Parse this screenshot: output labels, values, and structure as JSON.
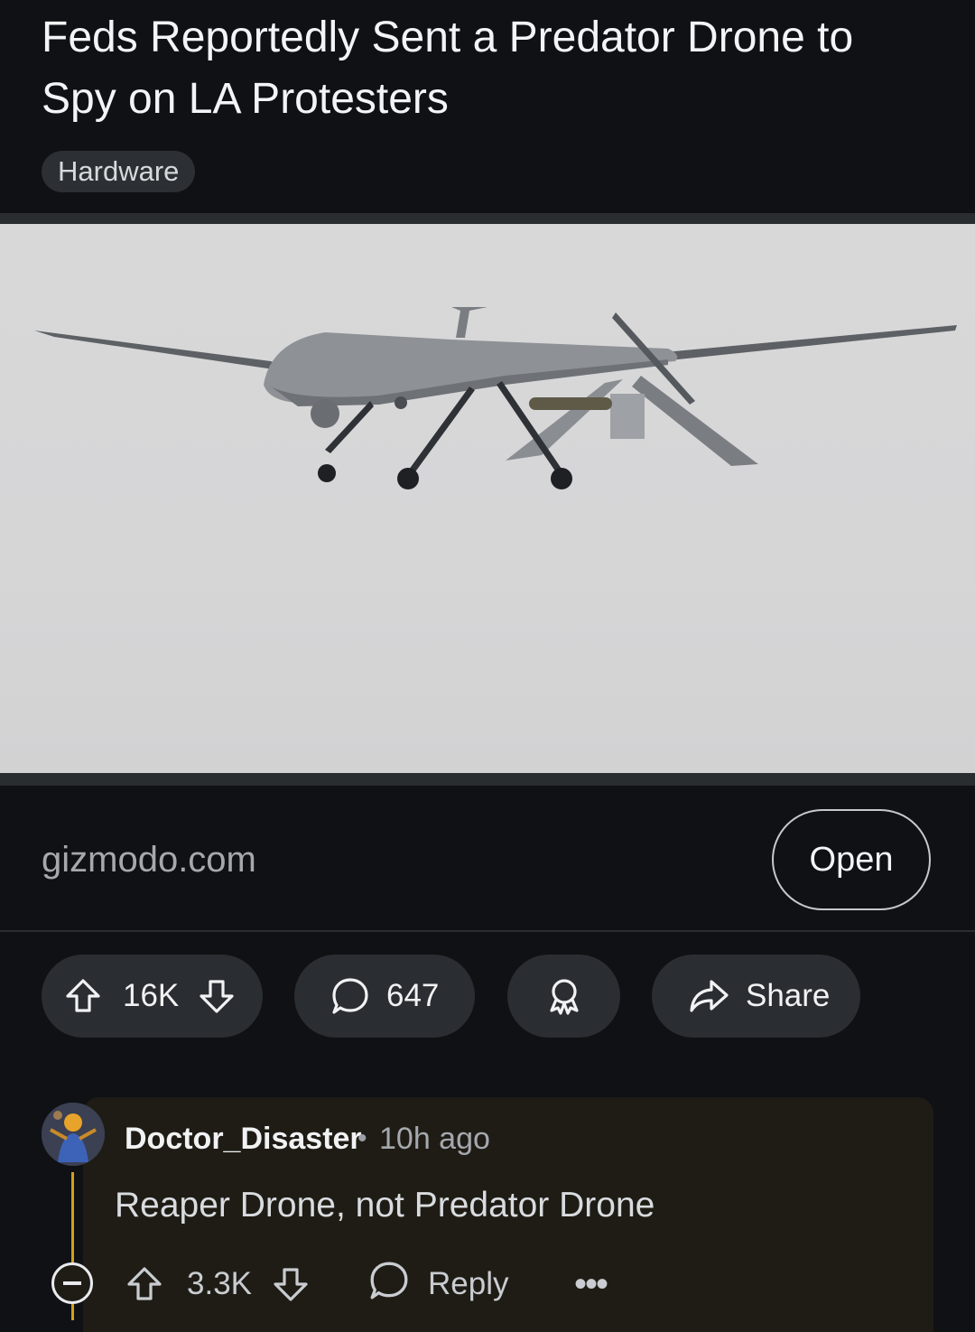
{
  "post": {
    "title": "Feds Reportedly Sent a Predator Drone to Spy on LA Protesters",
    "flair": "Hardware",
    "link_domain": "gizmodo.com",
    "open_label": "Open",
    "media_alt": "MQ-1 Predator drone in flight against overcast sky"
  },
  "actions": {
    "upvotes": "16K",
    "comments": "647",
    "share_label": "Share"
  },
  "comment": {
    "author": "Doctor_Disaster",
    "separator": "•",
    "time": "10h ago",
    "text": "Reaper Drone, not Predator Drone",
    "votes": "3.3K",
    "reply_label": "Reply",
    "more_label": "•••",
    "thread_color": "#d4a01a"
  },
  "icons": [
    "upvote-icon",
    "downvote-icon",
    "comment-icon",
    "award-icon",
    "share-icon",
    "collapse-icon",
    "reply-icon",
    "more-icon"
  ]
}
